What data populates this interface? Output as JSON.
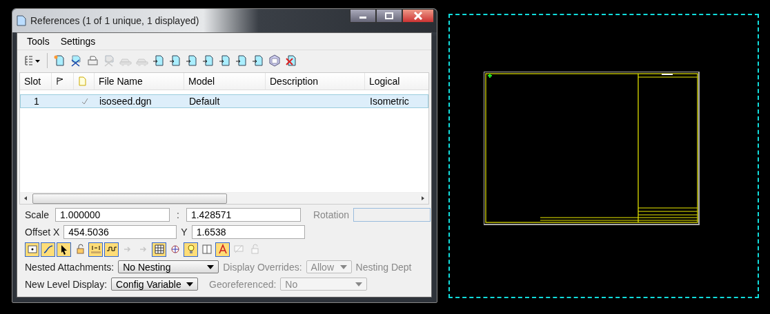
{
  "window": {
    "title": "References (1 of 1 unique, 1 displayed)"
  },
  "menu": [
    "Tools",
    "Settings"
  ],
  "toolbar": [
    {
      "disabled": false
    },
    {
      "disabled": false
    },
    {
      "disabled": false
    },
    {
      "disabled": false
    },
    {
      "disabled": true
    },
    {
      "disabled": true
    },
    {
      "disabled": true
    },
    {
      "disabled": false
    },
    {
      "disabled": false
    },
    {
      "disabled": false
    },
    {
      "disabled": false
    },
    {
      "disabled": false
    },
    {
      "disabled": false
    },
    {
      "disabled": false
    },
    {
      "disabled": false
    },
    {
      "disabled": false
    }
  ],
  "table": {
    "columns": [
      "Slot",
      "",
      "",
      "File Name",
      "Model",
      "Description",
      "Logical"
    ],
    "rows": [
      {
        "slot": "1",
        "displayed": true,
        "file_name": "isoseed.dgn",
        "model": "Default",
        "description": "",
        "logical": "Isometric",
        "selected": true
      }
    ]
  },
  "scale": {
    "label": "Scale",
    "value": "1.000000",
    "separator": ":",
    "value_2": "1.428571"
  },
  "rotation": {
    "label": "Rotation",
    "disabled": true
  },
  "offset": {
    "x_label": "Offset X",
    "x_value": "454.5036",
    "y_label": "Y",
    "y_value": "1.6538"
  },
  "toggles": [
    {
      "on": true,
      "disabled": false
    },
    {
      "on": true,
      "disabled": false
    },
    {
      "on": true,
      "disabled": false
    },
    {
      "on": false,
      "disabled": false
    },
    {
      "on": true,
      "disabled": false
    },
    {
      "on": true,
      "disabled": false
    },
    {
      "on": false,
      "disabled": true
    },
    {
      "on": false,
      "disabled": true
    },
    {
      "on": true,
      "disabled": false
    },
    {
      "on": false,
      "disabled": false
    },
    {
      "on": true,
      "disabled": false
    },
    {
      "on": false,
      "disabled": false
    },
    {
      "on": true,
      "disabled": false
    },
    {
      "on": false,
      "disabled": true
    },
    {
      "on": false,
      "disabled": true
    }
  ],
  "nested": {
    "label": "Nested Attachments:",
    "value": "No Nesting"
  },
  "overrides": {
    "label": "Display Overrides:",
    "value": "Allow",
    "disabled": true
  },
  "nesting_depth": {
    "label": "Nesting Dept"
  },
  "level_display": {
    "label": "New Level Display:",
    "value": "Config Variable"
  },
  "georeferenced": {
    "label": "Georeferenced:",
    "value": "No",
    "disabled": true
  }
}
